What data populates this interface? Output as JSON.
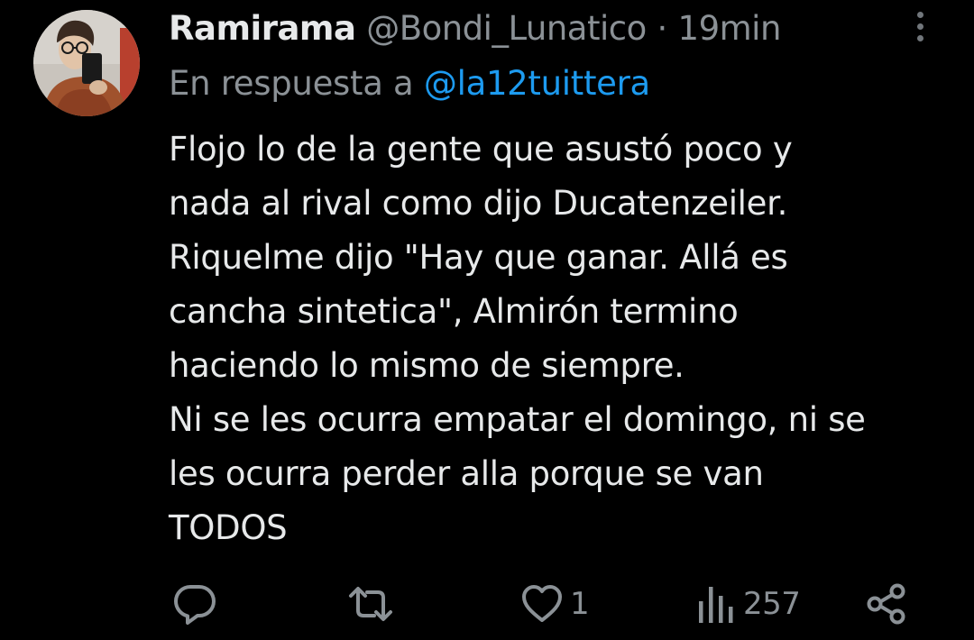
{
  "tweet": {
    "author_name": "Ramirama",
    "author_handle": "@Bondi_Lunatico",
    "separator": "·",
    "time": "19min",
    "reply_prefix": "En respuesta a",
    "reply_to": "@la12tuittera",
    "text_lines": [
      "Flojo lo de la gente que asustó poco y",
      "nada al rival como dijo Ducatenzeiler.",
      "Riquelme dijo \"Hay que ganar. Allá es",
      "cancha sintetica\", Almirón termino",
      "haciendo lo mismo de siempre.",
      "Ni se les ocurra empatar el domingo, ni se",
      "les ocurra perder alla porque se van",
      "TODOS"
    ]
  },
  "actions": {
    "reply": {
      "icon": "reply-icon"
    },
    "retweet": {
      "icon": "retweet-icon"
    },
    "like": {
      "icon": "heart-icon",
      "count": "1"
    },
    "views": {
      "icon": "views-icon",
      "count": "257"
    },
    "share": {
      "icon": "share-icon"
    }
  },
  "colors": {
    "background": "#000000",
    "text_primary": "#e7e9ea",
    "text_secondary": "#8b9196",
    "accent": "#1d9bf0"
  }
}
